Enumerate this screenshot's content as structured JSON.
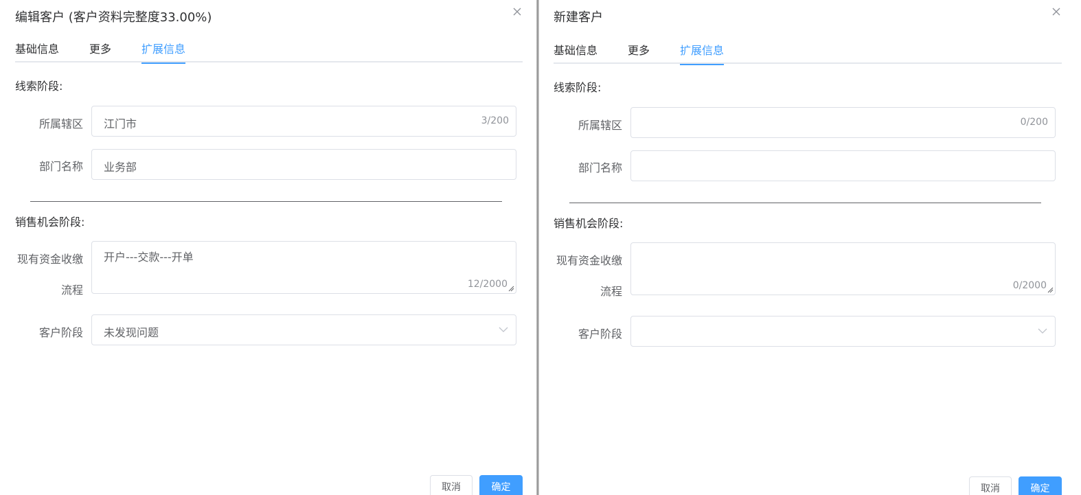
{
  "left_dialog": {
    "title": "编辑客户 (客户资料完整度33.00%)",
    "tabs": [
      "基础信息",
      "更多",
      "扩展信息"
    ],
    "active_tab": "扩展信息",
    "lead_stage": {
      "section_title": "线索阶段:",
      "district_label": "所属辖区",
      "district_value": "江门市",
      "district_count": "3/200",
      "department_label": "部门名称",
      "department_value": "业务部"
    },
    "sales_stage": {
      "section_title": "销售机会阶段:",
      "process_label_line1": "现有资金收缴",
      "process_label_line2": "流程",
      "process_value": "开户---交款---开单",
      "process_count": "12/2000",
      "customer_stage_label": "客户阶段",
      "customer_stage_value": "未发现问题"
    },
    "footer": {
      "cancel_label": "取消",
      "ok_label": "确定"
    }
  },
  "right_dialog": {
    "title": "新建客户",
    "tabs": [
      "基础信息",
      "更多",
      "扩展信息"
    ],
    "active_tab": "扩展信息",
    "lead_stage": {
      "section_title": "线索阶段:",
      "district_label": "所属辖区",
      "district_value": "",
      "district_count": "0/200",
      "department_label": "部门名称",
      "department_value": ""
    },
    "sales_stage": {
      "section_title": "销售机会阶段:",
      "process_label_line1": "现有资金收缴",
      "process_label_line2": "流程",
      "process_value": "",
      "process_count": "0/2000",
      "customer_stage_label": "客户阶段",
      "customer_stage_value": ""
    },
    "footer": {
      "cancel_label": "取消",
      "ok_label": "确定"
    }
  },
  "icons": {
    "close": "close-icon",
    "dropdown": "chevron-down-icon",
    "resize": "resize-handle-icon"
  },
  "colors": {
    "accent": "#409eff",
    "text": "#303133",
    "label": "#606266",
    "placeholder": "#909399",
    "border": "#dcdfe6"
  }
}
